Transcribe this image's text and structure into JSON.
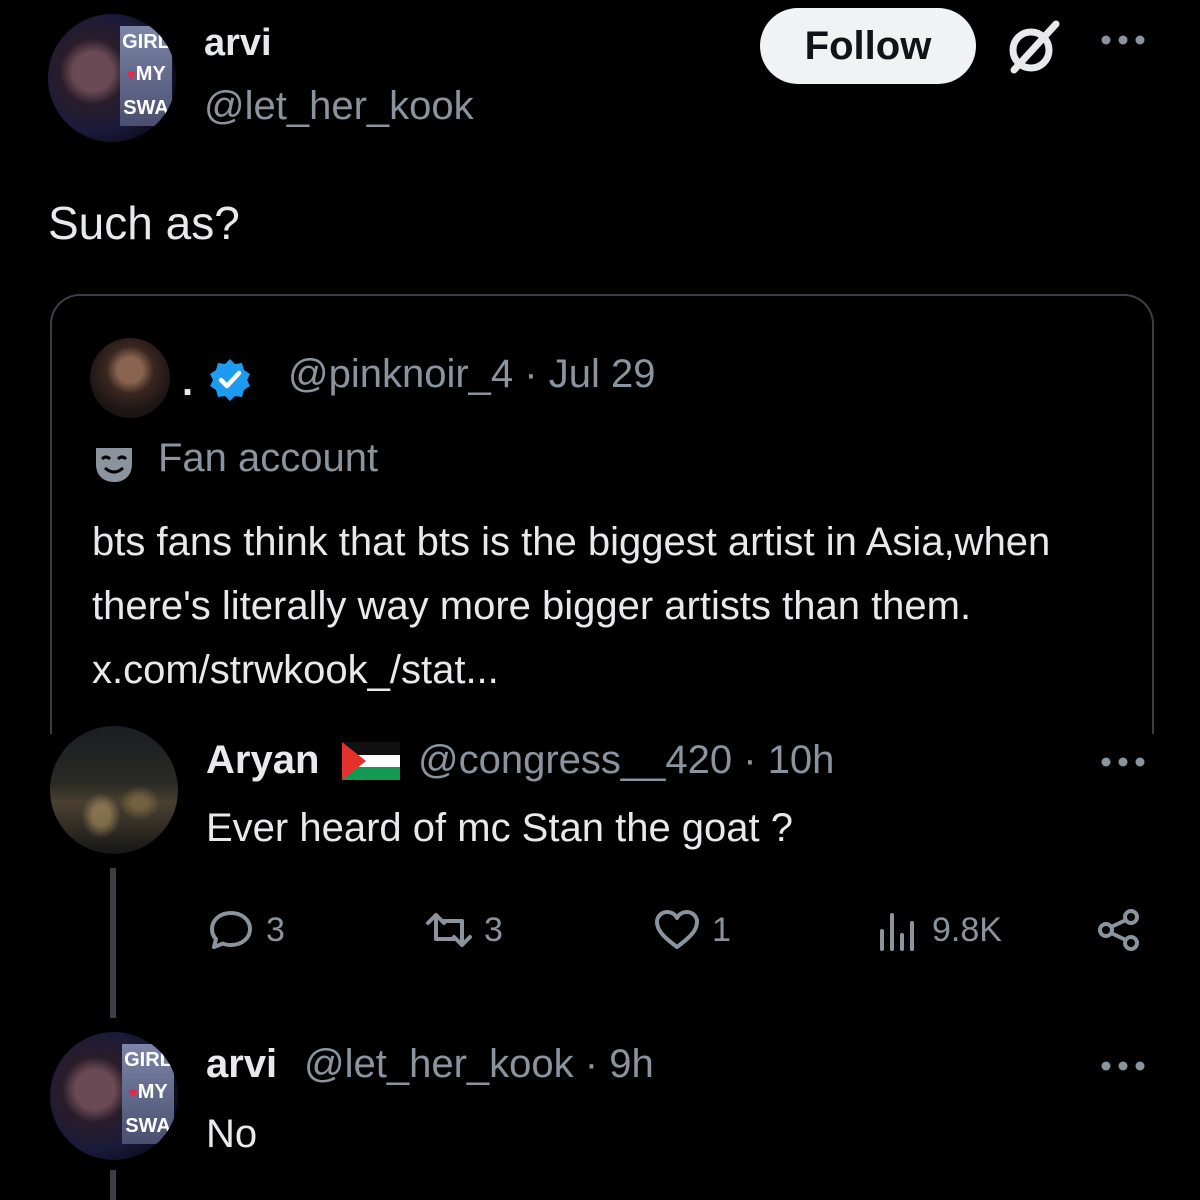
{
  "post": {
    "author_name": "arvi",
    "author_handle": "@let_her_kook",
    "follow_label": "Follow",
    "text": "Such as?",
    "avatar_text": [
      "GIRL",
      "MY",
      "SWA"
    ]
  },
  "quote": {
    "author_name": ".",
    "handle_date": "@pinknoir_4 · Jul 29",
    "label": "Fan account",
    "text": "bts fans think that bts is the biggest artist in Asia,when there's literally way more bigger artists than them. x.com/strwkook_/stat..."
  },
  "reply": {
    "author_name": "Aryan",
    "handle_time": "@congress__420 · 10h",
    "text": "Ever heard of mc Stan the goat ?",
    "stats": {
      "replies": "3",
      "reposts": "3",
      "likes": "1",
      "views": "9.8K"
    }
  },
  "reply2": {
    "author_name": "arvi",
    "handle_time": "@let_her_kook · 9h",
    "text": "No"
  },
  "colors": {
    "background": "#000000",
    "text": "#e7e9ea",
    "muted": "#8b949e",
    "verified": "#1d9bf0",
    "heart": "#e8254a"
  },
  "icons": [
    "verified-badge-icon",
    "grok-icon",
    "more-icon",
    "mask-icon",
    "palestine-flag-icon",
    "reply-icon",
    "repost-icon",
    "like-icon",
    "views-icon",
    "share-icon"
  ]
}
